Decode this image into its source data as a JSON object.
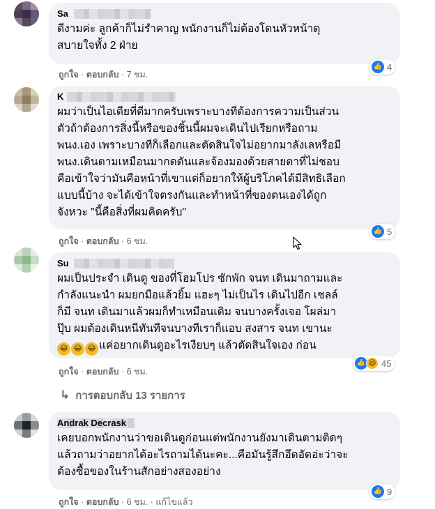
{
  "comments": [
    {
      "author": "Sa",
      "text": "ดีงามค่ะ ลูกค้าก็ไม่รำคาญ พนักงานก็ไม่ต้องโดนหัวหน้าดุ\nสบายใจทั้ง 2 ฝ่าย",
      "like_label": "ถูกใจ",
      "reply_label": "ตอบกลับ",
      "time": "7 ชม.",
      "reaction_count": "4",
      "avatar_colors": [
        "#5a4a5c",
        "#7d6a82",
        "#a48fa4",
        "#4b3d52",
        "#3f2c4a",
        "#6c5876",
        "#8a7a8d",
        "#574760",
        "#6e5f78"
      ]
    },
    {
      "author": "K",
      "text": "ผมว่าเป็นไอเดียที่ดีมากครับเพราะบางทีต้องการความเป็นส่วน\nตัวถ้าต้องการสิ่งนี้หรือของชิ้นนี้ผมจะเดินไปเรียกหรือถาม\nพนง.เอง เพราะบางทีก็เลือกและตัดสินใจไม่อยากมาลังเลหรือมี\nพนง.เดินตามเหมือนมากดดันและจ้องมองด้วยสายตาที่ไม่ชอบ\nคือเข้าใจว่ามันคือหน้าที่เขาแต่ก็อยากให้ผู้บริโภคได้มีสิทธิเลือก\nแบบนี้บ้าง จะได้เข้าใจตรงกันและทำหน้าที่ของตนเองได้ถูก\nจังหวะ \"นี้คือสิ่งที่ผมคิดครับ\"",
      "like_label": "ถูกใจ",
      "reply_label": "ตอบกลับ",
      "time": "6 ชม.",
      "reaction_count": "5",
      "avatar_colors": [
        "#c8bfa8",
        "#a89878",
        "#d8cfbd",
        "#b8a98f",
        "#8f7f60",
        "#c0b49c",
        "#dcd5c6",
        "#b3a78f",
        "#e4ded2"
      ]
    },
    {
      "author": "Su",
      "text": "ผมเป็นประจำ เดินดู ของที่โฮมโปร ซักพัก จนท เดินมาถามและ\nกำลังแนะนำ ผมยกมือแล้วยิ้ม แฮะๆ ไม่เป็นไร เดินไปอีก เชลล์\nก็มี จนท เดินมาแล้วผมก็ทำเหมือนเดิม จนบางครั้งเจอ โผล่มา\nปุ๊บ ผมต้องเดินหนีทันทีจนบางทีเราก็แอบ สงสาร จนท เขานะ",
      "text_last": "แค่อยากเดินดูอะไรเงียบๆ แล้วตัดสินใจเอง ก่อน",
      "emojis": [
        "😂",
        "😂",
        "😂"
      ],
      "like_label": "ถูกใจ",
      "reply_label": "ตอบกลับ",
      "time": "6 ชม.",
      "reaction_count": "45",
      "avatar_colors": [
        "#d9e6d8",
        "#b9d3b8",
        "#e6efe6",
        "#a9c8a8",
        "#8db98c",
        "#c6dcc5",
        "#dfeadf",
        "#b5cfb4",
        "#ebf2eb"
      ]
    },
    {
      "author": "Andrak Decrask",
      "text": "เคยบอกพนักงานว่าขอเดินดูก่อนแต่พนักงานยังมาเดินตามติดๆ\nแล้วถามว่าอยากได้อะไรถามได้นะคะ...คือมันรู้สึกอึดอัดอ่ะว่าจะ\nต้องซื้อของในร้านสักอย่างสองอย่าง",
      "like_label": "ถูกใจ",
      "reply_label": "ตอบกลับ",
      "time": "6 ชม.",
      "edited_label": "แก้ไขแล้ว",
      "reaction_count": "9",
      "avatar_colors": [
        "#c9cacd",
        "#9b9ca1",
        "#d8d9dc",
        "#6f7076",
        "#1f2530",
        "#8c8d93",
        "#d0d1d4",
        "#7a7b81",
        "#e1e2e4"
      ]
    }
  ],
  "replies_link": "การตอบกลับ 13 รายการ",
  "icons": {
    "like": "thumbs-up-icon",
    "haha": "laughing-face-icon",
    "reply_arrow": "reply-arrow-icon",
    "cursor": "mouse-pointer-icon"
  },
  "colors": {
    "bubble": "#f0f2f5",
    "like_blue": "#1877f2",
    "meta_gray": "#65676b"
  }
}
